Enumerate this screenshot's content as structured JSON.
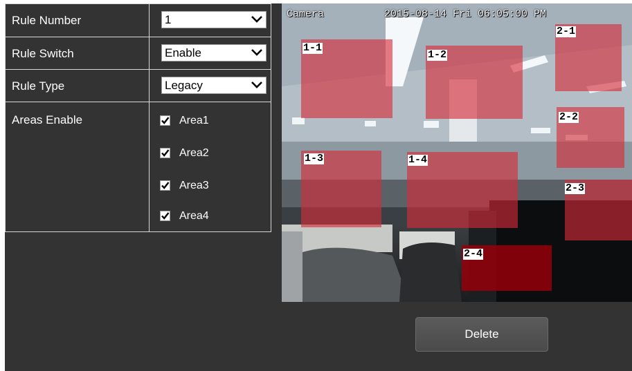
{
  "settings": {
    "rule_number": {
      "label": "Rule Number",
      "value": "1"
    },
    "rule_switch": {
      "label": "Rule Switch",
      "value": "Enable"
    },
    "rule_type": {
      "label": "Rule Type",
      "value": "Legacy"
    },
    "areas_enable": {
      "label": "Areas Enable",
      "areas": [
        {
          "label": "Area1",
          "checked": true
        },
        {
          "label": "Area2",
          "checked": true
        },
        {
          "label": "Area3",
          "checked": true
        },
        {
          "label": "Area4",
          "checked": true
        }
      ]
    }
  },
  "camera": {
    "name": "Camera",
    "timestamp": "2015-08-14 Fri 06:05:00 PM",
    "zones": [
      "1-1",
      "1-2",
      "2-1",
      "2-2",
      "1-3",
      "1-4",
      "2-3",
      "2-4"
    ]
  },
  "actions": {
    "delete_label": "Delete"
  },
  "colors": {
    "panel": "#333333",
    "zone_fill": "#d62c38",
    "zone_dark": "#96000a"
  }
}
